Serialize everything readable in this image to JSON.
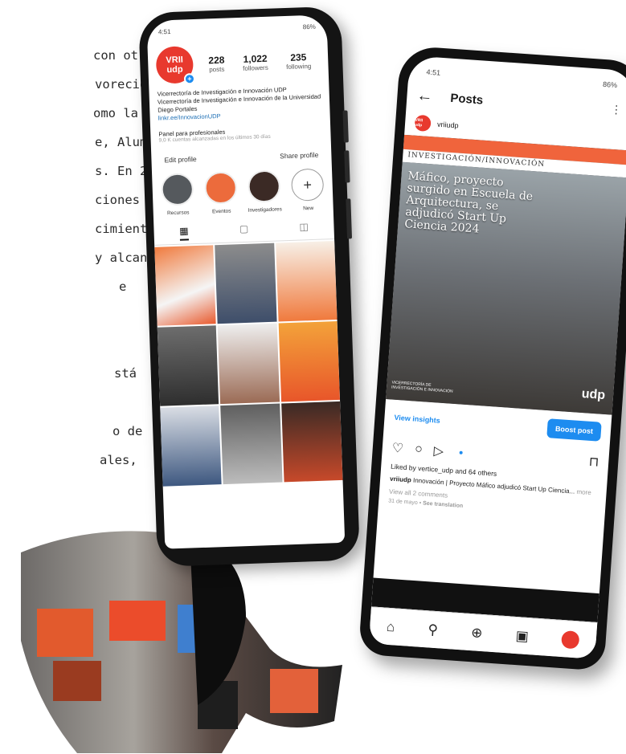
{
  "background_text": [
    "con otras",
    "vorecido",
    "omo la",
    "e, Alumni y",
    "s. En 2024,",
    "ciones y",
    "cimiento",
    "y alcance",
    "e",
    "stá",
    "o de",
    "ales,"
  ],
  "profile": {
    "status_time": "4:51",
    "status_right": "86%",
    "avatar_line1": "VRII",
    "avatar_line2": "udp",
    "posts_count": "228",
    "posts_label": "posts",
    "followers_count": "1,022",
    "followers_label": "followers",
    "following_count": "235",
    "following_label": "following",
    "bio_name": "Vicerrectoría de Investigación e Innovación UDP",
    "bio_line": "Vicerrectoría de Investigación e Innovación de la Universidad Diego Portales",
    "bio_link": "linkr.ee/InnovacionUDP",
    "panel_title": "Panel para profesionales",
    "panel_sub": "9,0 K cuentas alcanzadas en los últimos 30 días",
    "edit_profile": "Edit profile",
    "share_profile": "Share profile",
    "highlights": [
      "Recursos",
      "Eventos",
      "Investigadores",
      "New"
    ]
  },
  "post": {
    "status_time": "4:51",
    "status_right": "86%",
    "header_title": "Posts",
    "username": "vriiudp",
    "avatar_text": "VRII udp",
    "banner": "INVESTIGACIÓN/INNOVACIÓN",
    "headline": "Máfico, proyecto surgido en Escuela de Arquitectura, se adjudicó Start Up Ciencia 2024",
    "image_footer": "VICERRECTORÍA DE INVESTIGACIÓN E INNOVACIÓN",
    "image_logo": "udp",
    "view_insights": "View insights",
    "boost_post": "Boost post",
    "liked_by": "Liked by vertice_udp and 64 others",
    "caption_user": "vriiudp",
    "caption_text": "Innovación | Proyecto Máfico adjudicó Start Up Ciencia...",
    "caption_more": "more",
    "view_comments": "View all 2 comments",
    "date": "31 de mayo",
    "see_translation": "See translation"
  },
  "colors": {
    "accent_blue": "#1d8cf0",
    "brand_red": "#e8392e",
    "banner_orange": "#f0643c"
  }
}
